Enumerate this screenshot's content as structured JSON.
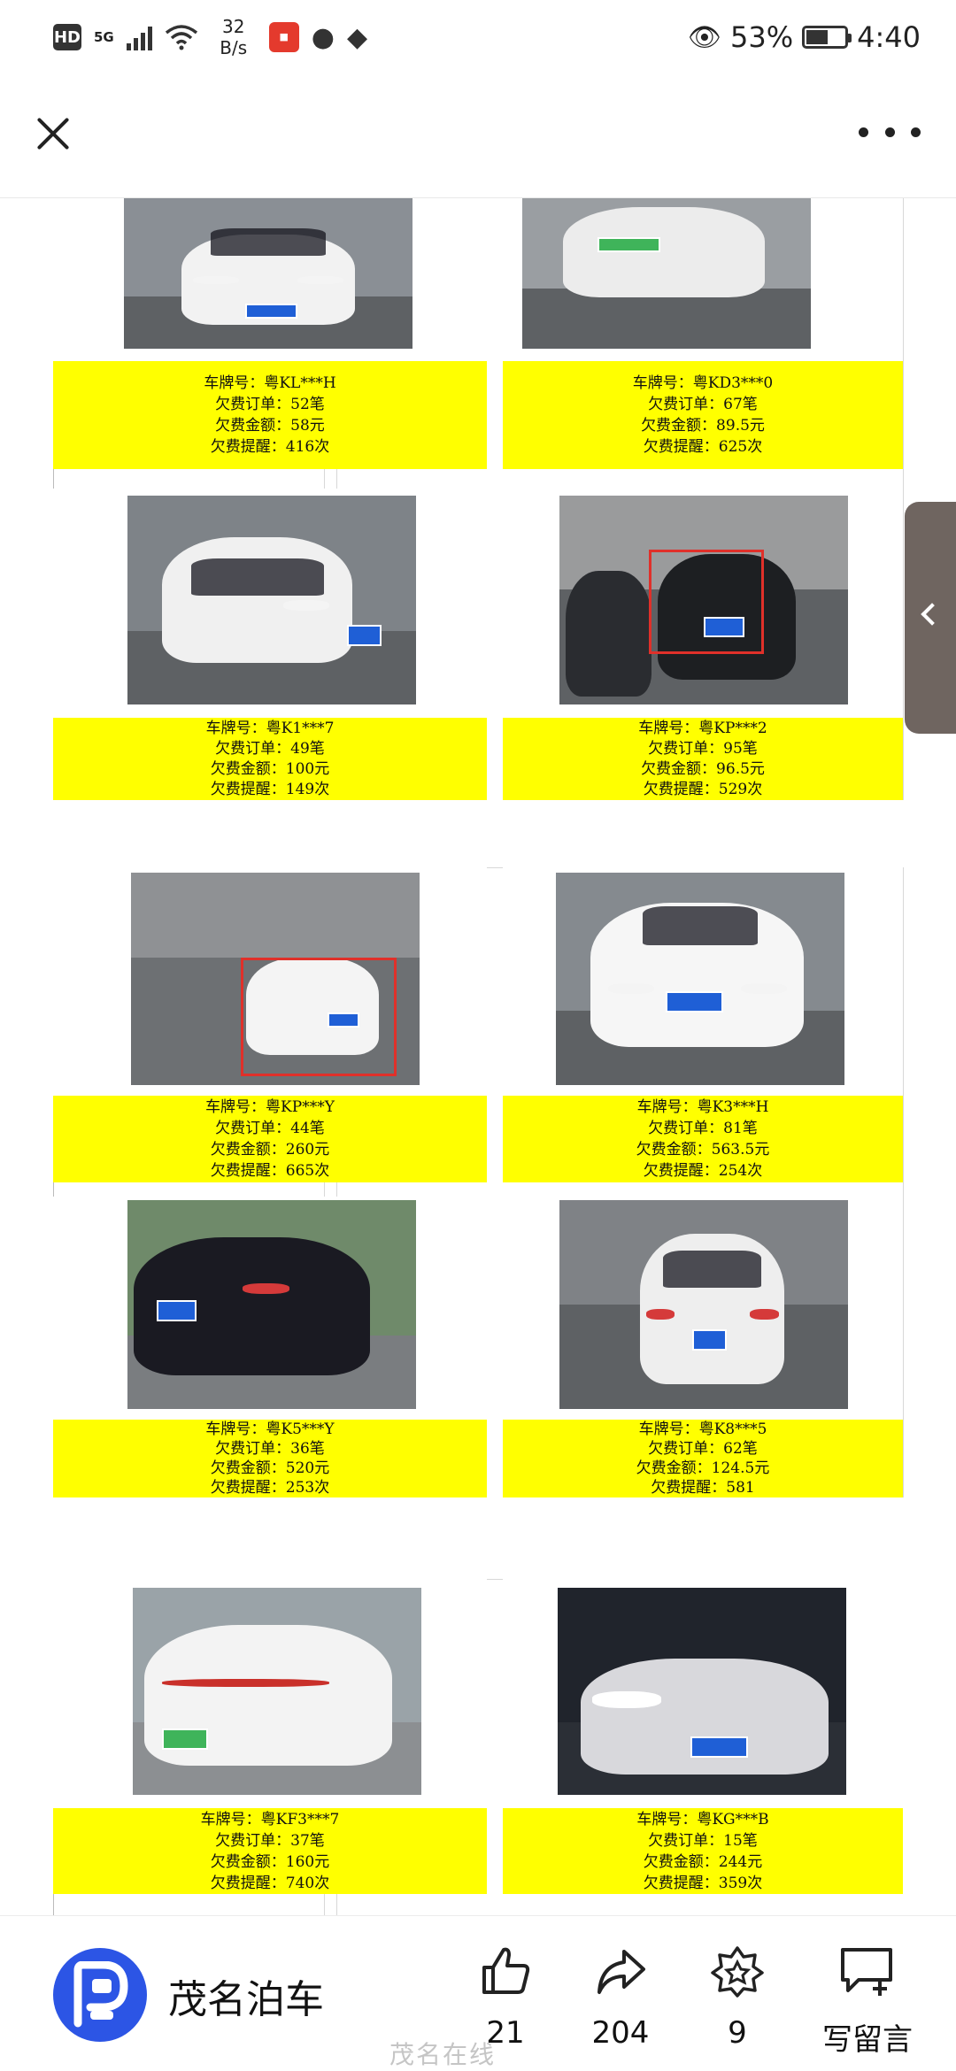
{
  "status_bar": {
    "network": "HD",
    "signal_gen": "5G",
    "net_speed_value": "32",
    "net_speed_unit": "B/s",
    "battery_percent": "53%",
    "time": "4:40",
    "icons": [
      "hd-icon",
      "signal-icon",
      "wifi-icon",
      "bank-app-icon",
      "wechat-icon",
      "alipay-icon",
      "eye-icon",
      "battery-icon"
    ]
  },
  "nav": {
    "close_icon": "close-icon",
    "more_icon": "more-icon"
  },
  "records": [
    {
      "plate": "车牌号：粤KL***H",
      "orders": "欠费订单：52笔",
      "amount": "欠费金额：58元",
      "reminders": "欠费提醒：416次",
      "plate_color": "#1f5fd6",
      "car_color": "#f2f2f2"
    },
    {
      "plate": "车牌号：粤KD3***0",
      "orders": "欠费订单：67笔",
      "amount": "欠费金额：89.5元",
      "reminders": "欠费提醒：625次",
      "plate_color": "#3fb45a",
      "car_color": "#ececec"
    },
    {
      "plate": "车牌号：粤K1***7",
      "orders": "欠费订单：49笔",
      "amount": "欠费金额：100元",
      "reminders": "欠费提醒：149次",
      "plate_color": "#1f5fd6",
      "car_color": "#f0f0f0"
    },
    {
      "plate": "车牌号：粤KP***2",
      "orders": "欠费订单：95笔",
      "amount": "欠费金额：96.5元",
      "reminders": "欠费提醒：529次",
      "plate_color": "#1f5fd6",
      "car_color": "#1d1f22"
    },
    {
      "plate": "车牌号：粤KP***Y",
      "orders": "欠费订单：44笔",
      "amount": "欠费金额：260元",
      "reminders": "欠费提醒：665次",
      "plate_color": "#1f5fd6",
      "car_color": "#f4f4f4"
    },
    {
      "plate": "车牌号：粤K3***H",
      "orders": "欠费订单：81笔",
      "amount": "欠费金额：563.5元",
      "reminders": "欠费提醒：254次",
      "plate_color": "#1f5fd6",
      "car_color": "#f6f6f6"
    },
    {
      "plate": "车牌号：粤K5***Y",
      "orders": "欠费订单：36笔",
      "amount": "欠费金额：520元",
      "reminders": "欠费提醒：253次",
      "plate_color": "#1f5fd6",
      "car_color": "#1a1a22"
    },
    {
      "plate": "车牌号：粤K8***5",
      "orders": "欠费订单：62笔",
      "amount": "欠费金额：124.5元",
      "reminders": "欠费提醒：581",
      "plate_color": "#1f5fd6",
      "car_color": "#eeeeee"
    },
    {
      "plate": "车牌号：粤KF3***7",
      "orders": "欠费订单：37笔",
      "amount": "欠费金额：160元",
      "reminders": "欠费提醒：740次",
      "plate_color": "#3fb45a",
      "car_color": "#f3f3f3"
    },
    {
      "plate": "车牌号：粤KG***B",
      "orders": "欠费订单：15笔",
      "amount": "欠费金额：244元",
      "reminders": "欠费提醒：359次",
      "plate_color": "#1f5fd6",
      "car_color": "#d8d8dc"
    }
  ],
  "bottom_bar": {
    "account_name": "茂名泊车",
    "likes": "21",
    "shares": "204",
    "favorites": "9",
    "comment_label": "写留言"
  },
  "watermark": "茂名在线"
}
